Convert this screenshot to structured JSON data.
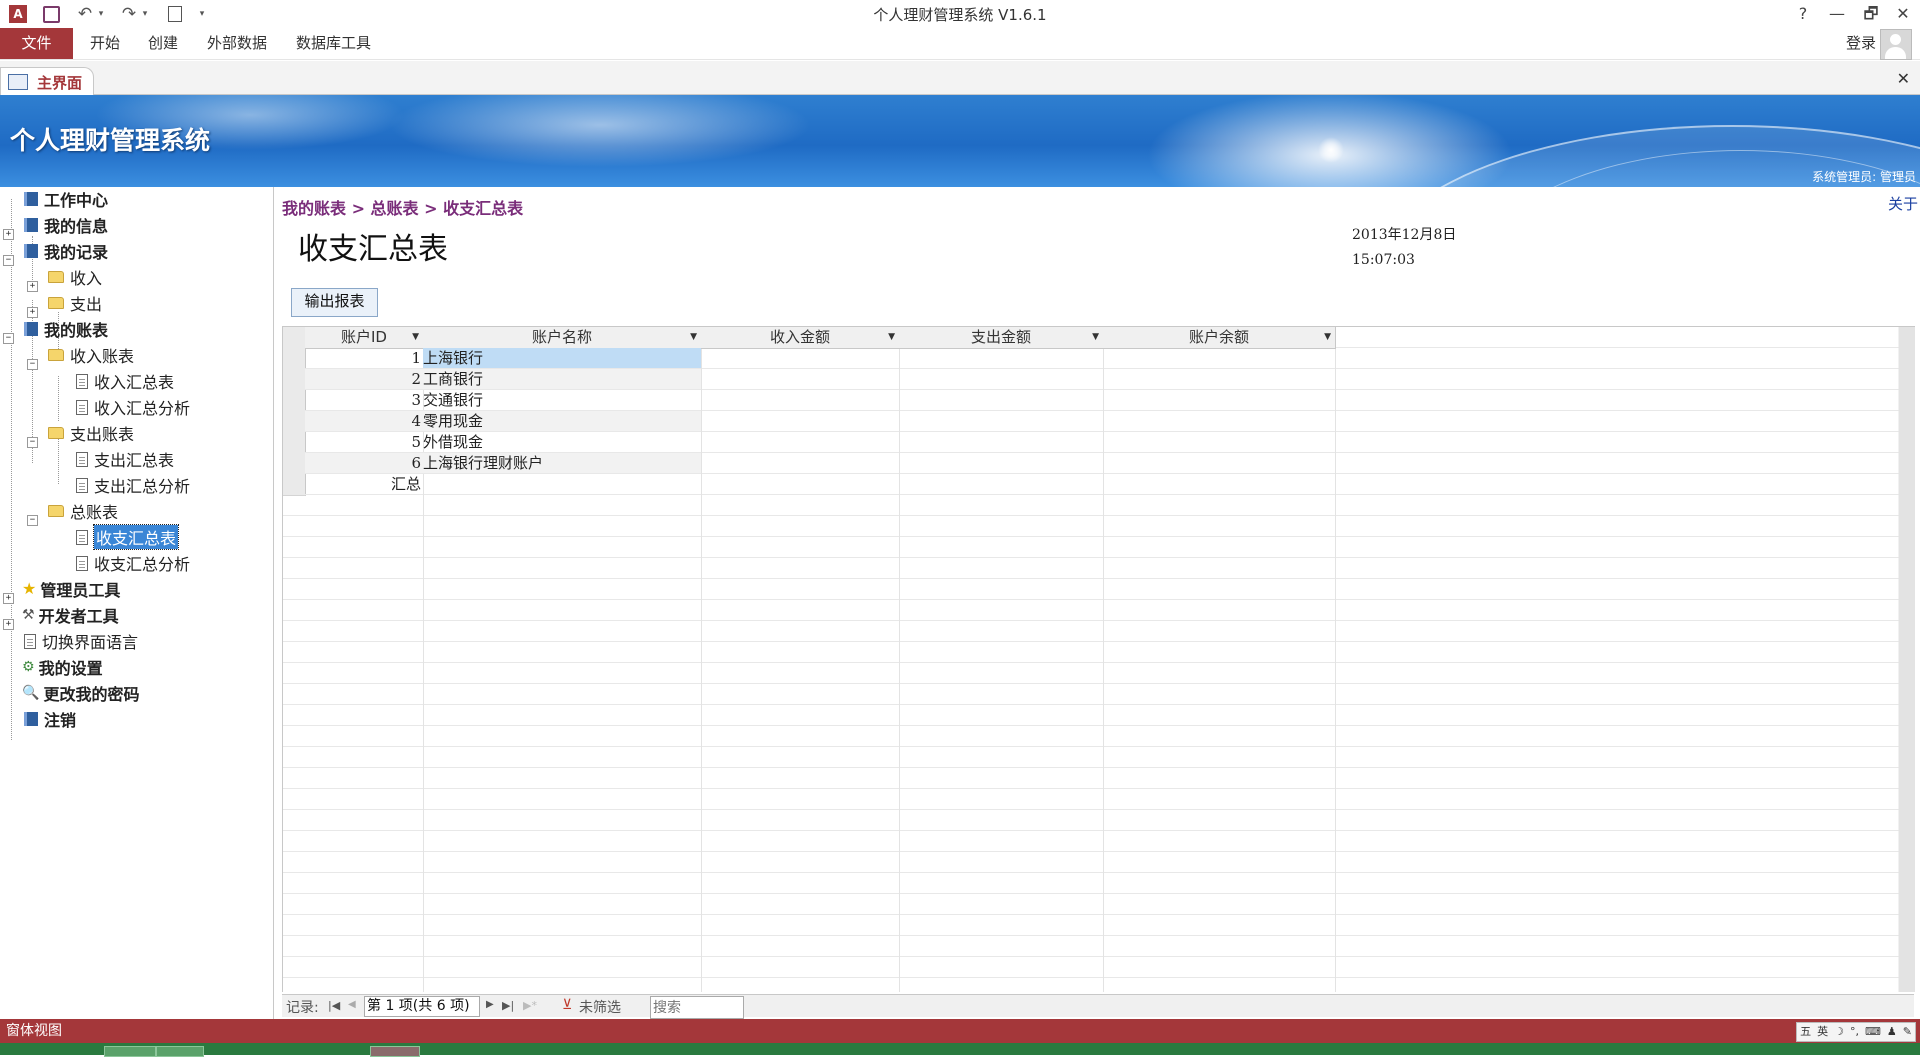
{
  "window": {
    "title": "个人理财管理系统 V1.6.1",
    "help": "?",
    "minimize": "—",
    "restore": "🗗",
    "close": "✕"
  },
  "ribbon": {
    "file": "文件",
    "tabs": [
      "开始",
      "创建",
      "外部数据",
      "数据库工具"
    ],
    "login": "登录"
  },
  "doc_tab": {
    "label": "主界面",
    "close": "✕"
  },
  "banner": {
    "title": "个人理财管理系统",
    "user": "系统管理员: 管理员"
  },
  "sidebar": {
    "nodes": [
      "工作中心",
      "我的信息",
      "我的记录",
      "收入",
      "支出",
      "我的账表",
      "收入账表",
      "收入汇总表",
      "收入汇总分析",
      "支出账表",
      "支出汇总表",
      "支出汇总分析",
      "总账表",
      "收支汇总表",
      "收支汇总分析",
      "管理员工具",
      "开发者工具",
      "切换界面语言",
      "我的设置",
      "更改我的密码",
      "注销"
    ]
  },
  "main": {
    "breadcrumb": "我的账表 > 总账表 > 收支汇总表",
    "about": "关于",
    "report_title": "收支汇总表",
    "date": "2013年12月8日",
    "time": "15:07:03",
    "export_label": "输出报表"
  },
  "grid": {
    "columns": [
      "账户ID",
      "账户名称",
      "收入金额",
      "支出金额",
      "账户余额"
    ],
    "rows": [
      {
        "id": "1",
        "name": "上海银行"
      },
      {
        "id": "2",
        "name": "工商银行"
      },
      {
        "id": "3",
        "name": "交通银行"
      },
      {
        "id": "4",
        "name": "零用现金"
      },
      {
        "id": "5",
        "name": "外借现金"
      },
      {
        "id": "6",
        "name": "上海银行理财账户"
      }
    ],
    "total_label": "汇总"
  },
  "record_nav": {
    "label": "记录:",
    "position": "第 1 项(共 6 项)",
    "filter": "未筛选",
    "search_placeholder": "搜索"
  },
  "status": {
    "label": "窗体视图",
    "ime": [
      "五",
      "英",
      "☽",
      "°,",
      "⌨",
      "♟",
      "✎"
    ]
  },
  "colors": {
    "accent": "#a4373a",
    "breadcrumb": "#7a2d7a",
    "selection": "#3a86d6"
  }
}
